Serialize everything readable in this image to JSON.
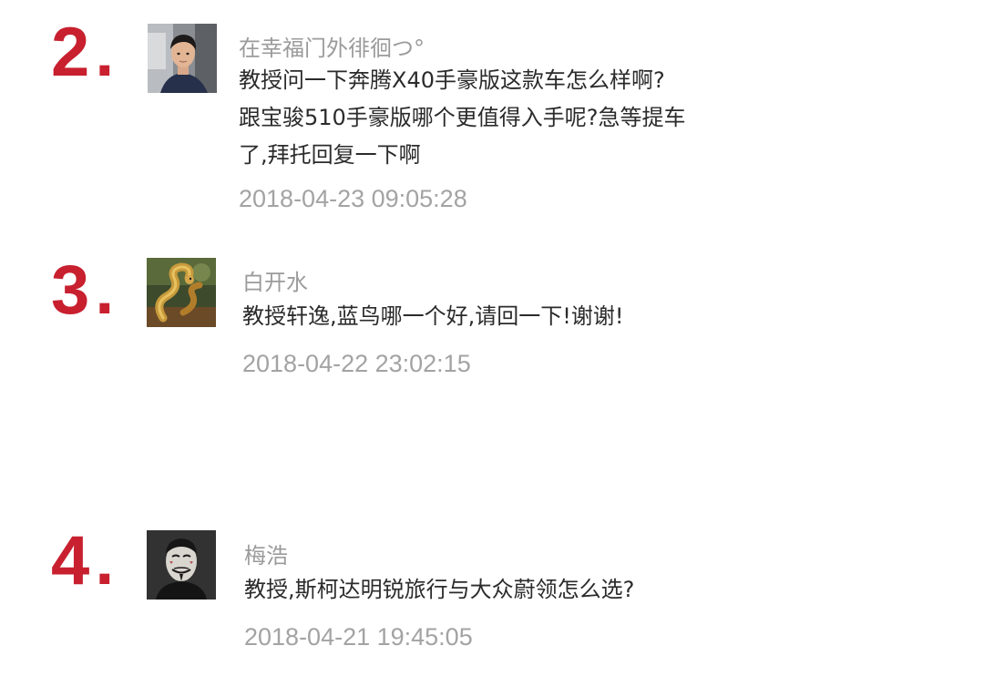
{
  "comments": [
    {
      "rank": "2.",
      "username": "在幸福门外徘徊つ°",
      "avatar": "avatar-young-man-photo",
      "lines": [
        "教授问一下奔腾X40手豪版这款车怎么样啊?",
        "跟宝骏510手豪版哪个更值得入手呢?急等提车",
        "了,拜托回复一下啊"
      ],
      "timestamp": "2018-04-23 09:05:28"
    },
    {
      "rank": "3.",
      "username": "白开水",
      "avatar": "avatar-snake-artwork",
      "lines": [
        "教授轩逸,蓝鸟哪一个好,请回一下!谢谢!"
      ],
      "timestamp": "2018-04-22 23:02:15"
    },
    {
      "rank": "4.",
      "username": "梅浩",
      "avatar": "avatar-guy-fawkes-mask",
      "lines": [
        "教授,斯柯达明锐旅行与大众蔚领怎么选?"
      ],
      "timestamp": "2018-04-21 19:45:05"
    }
  ],
  "colors": {
    "rank": "#c8202f",
    "username": "#9b9b9b",
    "text": "#2b2b2b",
    "timestamp": "#a3a3a3"
  }
}
